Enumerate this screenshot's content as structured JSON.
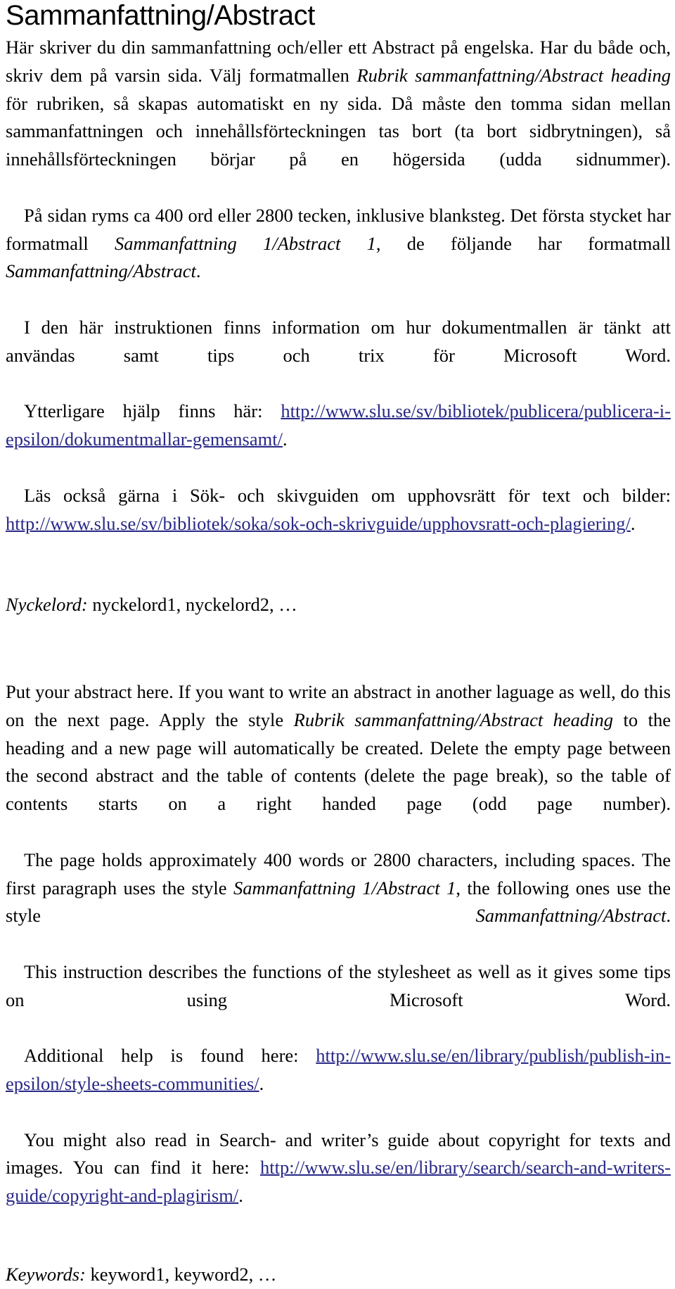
{
  "document": {
    "heading": "Sammanfattning/Abstract",
    "link_color": "#282887",
    "text_color": "#000000",
    "background_color": "#ffffff",
    "swedish_section": {
      "paragraph_1": {
        "part_1": "Här skriver du din sammanfattning och/eller ett Abstract på engelska. Har du både och, skriv dem på varsin sida. Välj formatmallen ",
        "style_name_1": "Rubrik sammanfattning/Abstract heading",
        "part_2": " för rubriken, så skapas automatiskt en ny sida. Då måste den tomma sidan mellan sammanfattningen och innehållsförteckningen tas bort (ta bort sidbrytningen), så innehållsförteckningen börjar på en högersida (udda sidnummer)."
      },
      "paragraph_2": {
        "part_1": "På sidan ryms ca 400 ord eller 2800 tecken, inklusive blanksteg. Det första stycket har formatmall ",
        "style_name_1": "Sammanfattning 1/Abstract 1",
        "part_2": ", de följande har formatmall ",
        "style_name_2": "Sammanfattning/Abstract",
        "part_3": "."
      },
      "paragraph_3": {
        "text": "I den här instruktionen finns information om hur dokumentmallen är tänkt att användas samt tips och trix för Microsoft Word."
      },
      "paragraph_4": {
        "prefix": "Ytterligare hjälp finns här: ",
        "url": "http://www.slu.se/sv/bibliotek/publicera/publicera-i-epsilon/dokumentmallar-gemensamt/",
        "suffix": "."
      },
      "paragraph_5": {
        "prefix": "Läs också gärna i Sök- och skivguiden om upphovsrätt för text och bilder: ",
        "url": "http://www.slu.se/sv/bibliotek/soka/sok-och-skrivguide/upphovsratt-och-plagiering/",
        "suffix": "."
      },
      "keywords": {
        "label": "Nyckelord:",
        "value": " nyckelord1, nyckelord2, …"
      }
    },
    "english_section": {
      "paragraph_1": {
        "part_1": "Put your abstract here. If you want to write an abstract in another laguage as well, do this on the next page. Apply the style ",
        "style_name_1": "Rubrik sammanfattning/Abstract heading",
        "part_2": " to the heading and a new page will automatically be created. Delete the empty page between the second abstract and the table of contents (delete the page break), so the table of contents starts on a right handed page (odd page number)."
      },
      "paragraph_2": {
        "part_1": "The page holds approximately 400 words or 2800 characters, including spaces. The first paragraph uses the style ",
        "style_name_1": "Sammanfattning 1/Abstract 1",
        "part_2": ", the following ones use the style ",
        "style_name_2": "Sammanfattning/Abstract",
        "part_3": "."
      },
      "paragraph_3": {
        "text": "This instruction describes the functions of the stylesheet as well as it gives some tips on using Microsoft Word."
      },
      "paragraph_4": {
        "prefix": "Additional help is found here: ",
        "url": "http://www.slu.se/en/library/publish/publish-in-epsilon/style-sheets-communities/",
        "suffix": "."
      },
      "paragraph_5": {
        "prefix": "You might also read in Search- and writer’s guide about copyright for texts and images. You can find it here: ",
        "url": "http://www.slu.se/en/library/search/search-and-writers-guide/copyright-and-plagirism/",
        "suffix": "."
      },
      "keywords": {
        "label": "Keywords:",
        "value": " keyword1, keyword2, …"
      }
    }
  }
}
